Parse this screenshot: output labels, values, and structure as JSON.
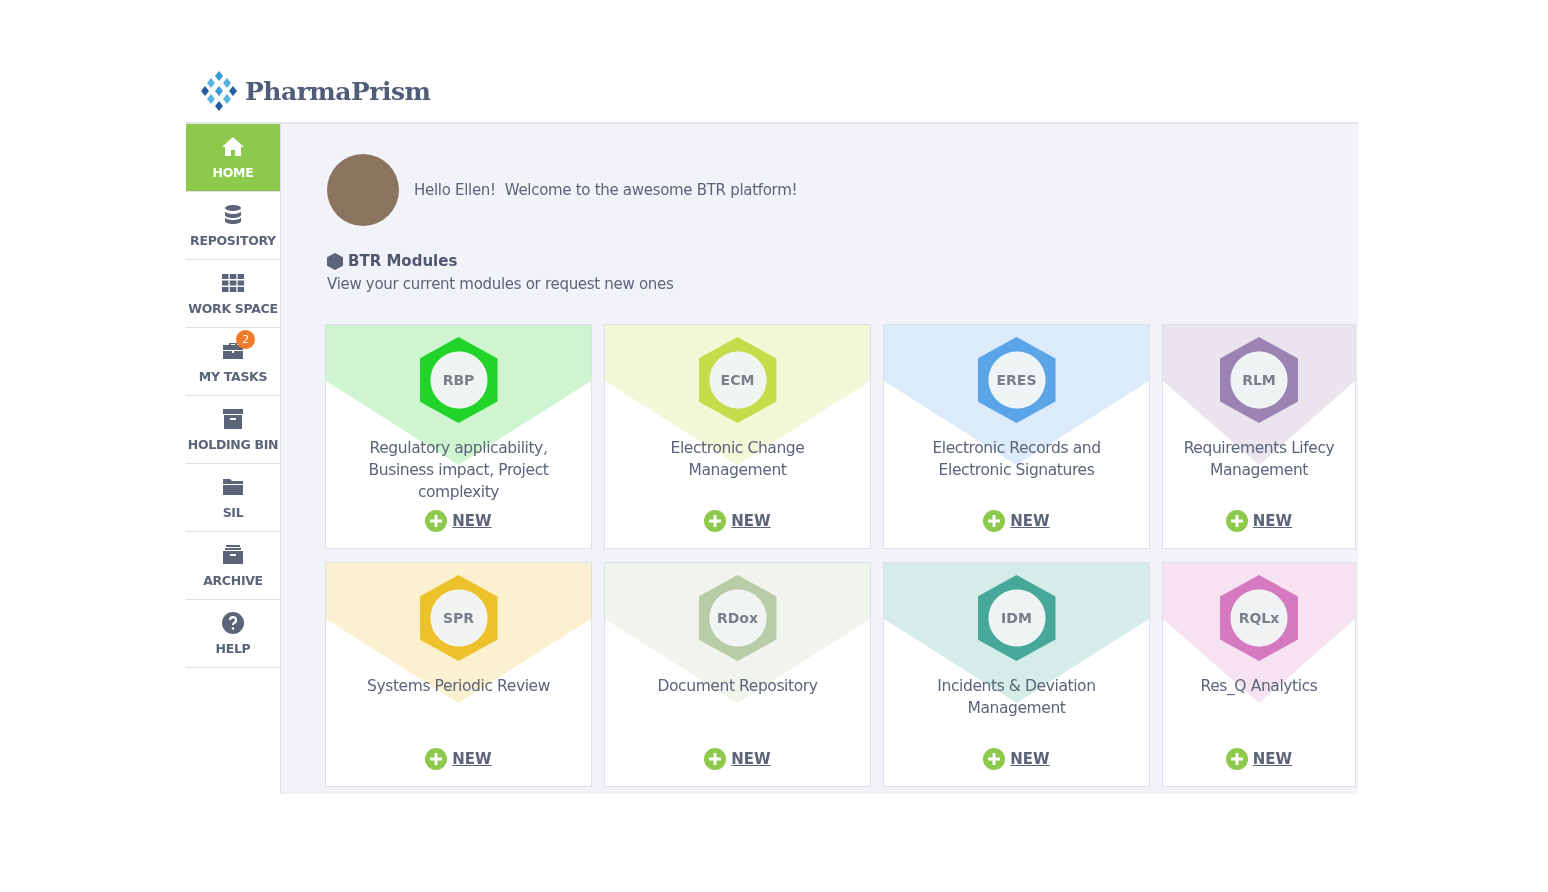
{
  "brand": {
    "name": "PharmaPrism"
  },
  "sidebar": {
    "items": [
      {
        "kind": "home",
        "label": "HOME",
        "selected": true
      },
      {
        "kind": "database",
        "label": "REPOSITORY",
        "selected": false
      },
      {
        "kind": "grid",
        "label": "WORK SPACE",
        "selected": false
      },
      {
        "kind": "briefcase",
        "label": "MY TASKS",
        "selected": false,
        "badge": "2"
      },
      {
        "kind": "box",
        "label": "HOLDING BIN",
        "selected": false
      },
      {
        "kind": "folder",
        "label": "SIL",
        "selected": false
      },
      {
        "kind": "archive",
        "label": "ARCHIVE",
        "selected": false
      },
      {
        "kind": "help",
        "label": "HELP",
        "selected": false
      }
    ]
  },
  "greeting": {
    "hello": "Hello Ellen!",
    "message": "Welcome to the awesome BTR platform!"
  },
  "section": {
    "title": "BTR Modules",
    "subtitle": "View your current modules or request new ones"
  },
  "modules": [
    {
      "code": "RBP",
      "title": "Regulatory applicability, Business impact, Project complexity",
      "color": "#22d32a",
      "action": "NEW"
    },
    {
      "code": "ECM",
      "title": "Electronic Change Management",
      "color": "#c7dc4a",
      "action": "NEW"
    },
    {
      "code": "ERES",
      "title": "Electronic Records and Electronic Signatures",
      "color": "#5aa5e8",
      "action": "NEW"
    },
    {
      "code": "RLM",
      "title": "Requirements Lifecy Management",
      "color": "#9b84b3",
      "action": "NEW"
    },
    {
      "code": "SPR",
      "title": "Systems Periodic Review",
      "color": "#edc12a",
      "action": "NEW"
    },
    {
      "code": "RDox",
      "title": "Document Repository",
      "color": "#b9cca8",
      "action": "NEW"
    },
    {
      "code": "IDM",
      "title": "Incidents & Deviation Management",
      "color": "#46a899",
      "action": "NEW"
    },
    {
      "code": "RQLx",
      "title": "Res_Q Analytics",
      "color": "#d579c0",
      "action": "NEW"
    }
  ]
}
